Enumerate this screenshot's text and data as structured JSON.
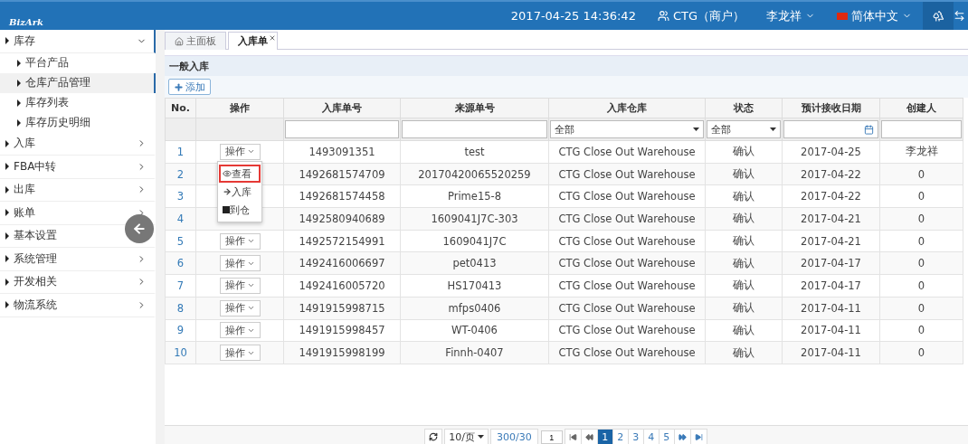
{
  "header": {
    "logo": "BizArk",
    "datetime": "2017-04-25 14:36:42",
    "account": "CTG（商户）",
    "user": "李龙祥",
    "language": "简体中文"
  },
  "sidebar": {
    "items": [
      {
        "label": "库存",
        "expanded": true,
        "children": [
          {
            "label": "平台产品",
            "selected": false
          },
          {
            "label": "仓库产品管理",
            "selected": true
          },
          {
            "label": "库存列表",
            "selected": false
          },
          {
            "label": "库存历史明细",
            "selected": false
          }
        ]
      },
      {
        "label": "入库",
        "expanded": false
      },
      {
        "label": "FBA中转",
        "expanded": false
      },
      {
        "label": "出库",
        "expanded": false
      },
      {
        "label": "账单",
        "expanded": false
      },
      {
        "label": "基本设置",
        "expanded": false
      },
      {
        "label": "系统管理",
        "expanded": false
      },
      {
        "label": "开发相关",
        "expanded": false
      },
      {
        "label": "物流系统",
        "expanded": false
      }
    ]
  },
  "tabs": [
    {
      "label": "主面板",
      "selected": false,
      "kind": "home"
    },
    {
      "label": "入库单",
      "selected": true,
      "kind": "closable"
    }
  ],
  "panel": {
    "title": "一般入库",
    "add_button": "添加"
  },
  "table": {
    "columns": [
      "No.",
      "操作",
      "入库单号",
      "来源单号",
      "入库仓库",
      "状态",
      "预计接收日期",
      "创建人"
    ],
    "filters": [
      {
        "kind": "none"
      },
      {
        "kind": "none"
      },
      {
        "kind": "text"
      },
      {
        "kind": "text"
      },
      {
        "kind": "select",
        "value": "全部"
      },
      {
        "kind": "select",
        "value": "全部"
      },
      {
        "kind": "date"
      },
      {
        "kind": "text"
      }
    ],
    "rows": [
      {
        "cells": [
          "1",
          "操作",
          "1493091351",
          "test",
          "CTG Close Out Warehouse",
          "确认",
          "2017-04-25",
          "李龙祥"
        ]
      },
      {
        "cells": [
          "2",
          "",
          "1492681574709",
          "20170420065520259",
          "CTG Close Out Warehouse",
          "确认",
          "2017-04-22",
          "0"
        ]
      },
      {
        "cells": [
          "3",
          "",
          "1492681574458",
          "Prime15-8",
          "CTG Close Out Warehouse",
          "确认",
          "2017-04-22",
          "0"
        ]
      },
      {
        "cells": [
          "4",
          "",
          "1492580940689",
          "1609041J7C-303",
          "CTG Close Out Warehouse",
          "确认",
          "2017-04-21",
          "0"
        ]
      },
      {
        "cells": [
          "5",
          "操作",
          "1492572154991",
          "1609041J7C",
          "CTG Close Out Warehouse",
          "确认",
          "2017-04-21",
          "0"
        ]
      },
      {
        "cells": [
          "6",
          "操作",
          "1492416006697",
          "pet0413",
          "CTG Close Out Warehouse",
          "确认",
          "2017-04-17",
          "0"
        ]
      },
      {
        "cells": [
          "7",
          "操作",
          "1492416005720",
          "HS170413",
          "CTG Close Out Warehouse",
          "确认",
          "2017-04-17",
          "0"
        ]
      },
      {
        "cells": [
          "8",
          "操作",
          "1491915998715",
          "mfps0406",
          "CTG Close Out Warehouse",
          "确认",
          "2017-04-11",
          "0"
        ]
      },
      {
        "cells": [
          "9",
          "操作",
          "1491915998457",
          "WT-0406",
          "CTG Close Out Warehouse",
          "确认",
          "2017-04-11",
          "0"
        ]
      },
      {
        "cells": [
          "10",
          "操作",
          "1491915998199",
          "Finnh-0407",
          "CTG Close Out Warehouse",
          "确认",
          "2017-04-11",
          "0"
        ]
      }
    ]
  },
  "action_menu": {
    "items": [
      {
        "label": "查看",
        "kind": "view",
        "selected": true
      },
      {
        "label": "入库",
        "kind": "arrow",
        "selected": false
      },
      {
        "label": "到仓",
        "kind": "square",
        "selected": false
      }
    ]
  },
  "pagination": {
    "page_size": "10/页",
    "total": "300/30",
    "page_input": "1",
    "pages": [
      {
        "label": "1",
        "selected": true
      },
      {
        "label": "2",
        "selected": false
      },
      {
        "label": "3",
        "selected": false
      },
      {
        "label": "4",
        "selected": false
      },
      {
        "label": "5",
        "selected": false
      }
    ]
  }
}
